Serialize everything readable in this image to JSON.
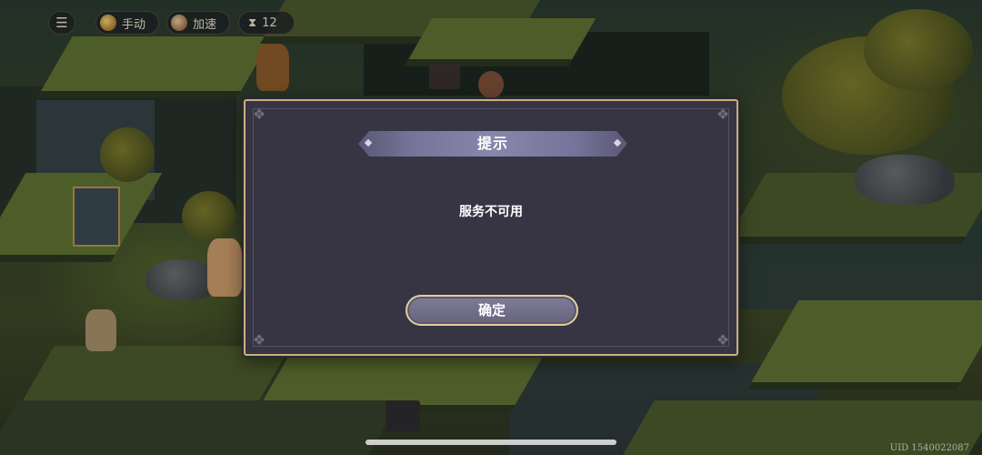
{
  "hud": {
    "menu_icon": "list-icon",
    "manual_label": "手动",
    "manual_icon": "gear-coin-icon",
    "speed_label": "加速",
    "speed_icon": "flower-icon",
    "turn_icon": "hourglass-icon",
    "turn_count": "12"
  },
  "dialog": {
    "title": "提示",
    "message": "服务不可用",
    "confirm_label": "确定"
  },
  "footer": {
    "uid": "UID 1540022087"
  },
  "colors": {
    "dialog_bg": "#373544",
    "dialog_border": "#c8b27c",
    "title_bar": "#8886aa",
    "button": "#6f6d88"
  }
}
